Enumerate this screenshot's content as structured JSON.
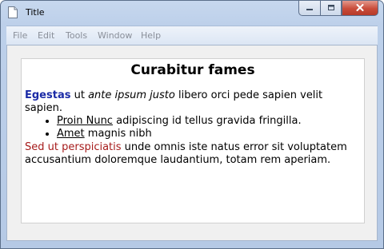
{
  "window": {
    "title": "Title"
  },
  "menu": {
    "items": [
      "File",
      "Edit",
      "Tools",
      "Window",
      "Help"
    ]
  },
  "document": {
    "heading": "Curabitur fames",
    "para1": {
      "strong": "Egestas",
      "text1": " ut ",
      "italic": "ante ipsum justo",
      "text2": " libero orci pede sapien velit sapien."
    },
    "list": [
      {
        "link": "Proin Nunc",
        "rest": " adipiscing id tellus gravida fringilla."
      },
      {
        "link": "Amet",
        "rest": " magnis nibh"
      }
    ],
    "para2": {
      "red": "Sed ut perspiciatis",
      "text": " unde omnis iste natus error sit voluptatem accusantium doloremque laudantium, totam rem aperiam."
    }
  },
  "colors": {
    "strong_blue": "#1a2aa6",
    "red_text": "#a61b1b",
    "menu_disabled": "#8a8f99",
    "close_button": "#c94c3a"
  },
  "icons": {
    "title": "document-icon",
    "minimize": "minimize-icon",
    "maximize": "maximize-icon",
    "close": "close-icon"
  }
}
